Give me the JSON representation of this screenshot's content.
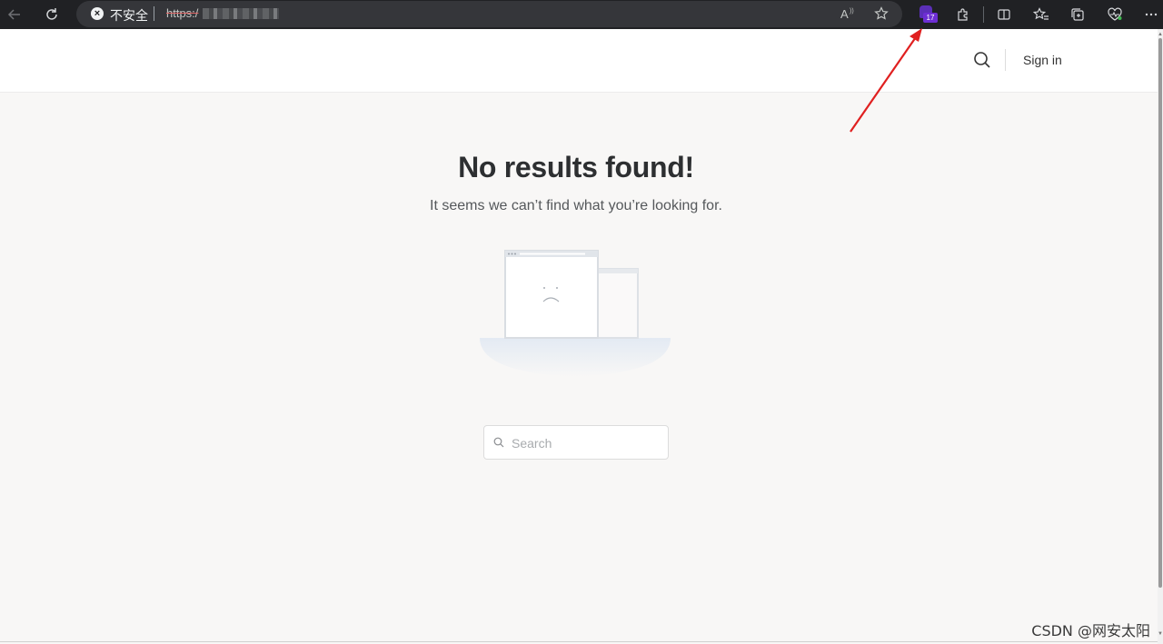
{
  "browser": {
    "security_label": "不安全",
    "url_prefix": "https:/",
    "extension_badge": "17",
    "icons": [
      "back-arrow-icon",
      "reload-icon",
      "not-secure-icon",
      "read-aloud-icon",
      "favorite-star-icon",
      "extension-badge-icon",
      "extensions-puzzle-icon",
      "split-screen-icon",
      "favorites-icon",
      "collections-icon",
      "browser-essentials-icon",
      "more-menu-icon"
    ]
  },
  "header": {
    "sign_in": "Sign in",
    "search_icon": "search-icon"
  },
  "main": {
    "title": "No results found!",
    "subtitle": "It seems we can’t find what you’re looking for.",
    "search_placeholder": "Search",
    "illustration": "sad-browser-window-illustration"
  },
  "watermark": "CSDN @网安太阳",
  "colors": {
    "chrome_bg": "#202124",
    "page_bg": "#f8f7f6",
    "badge": "#6d2ed4",
    "annotation_arrow": "#e02020"
  }
}
